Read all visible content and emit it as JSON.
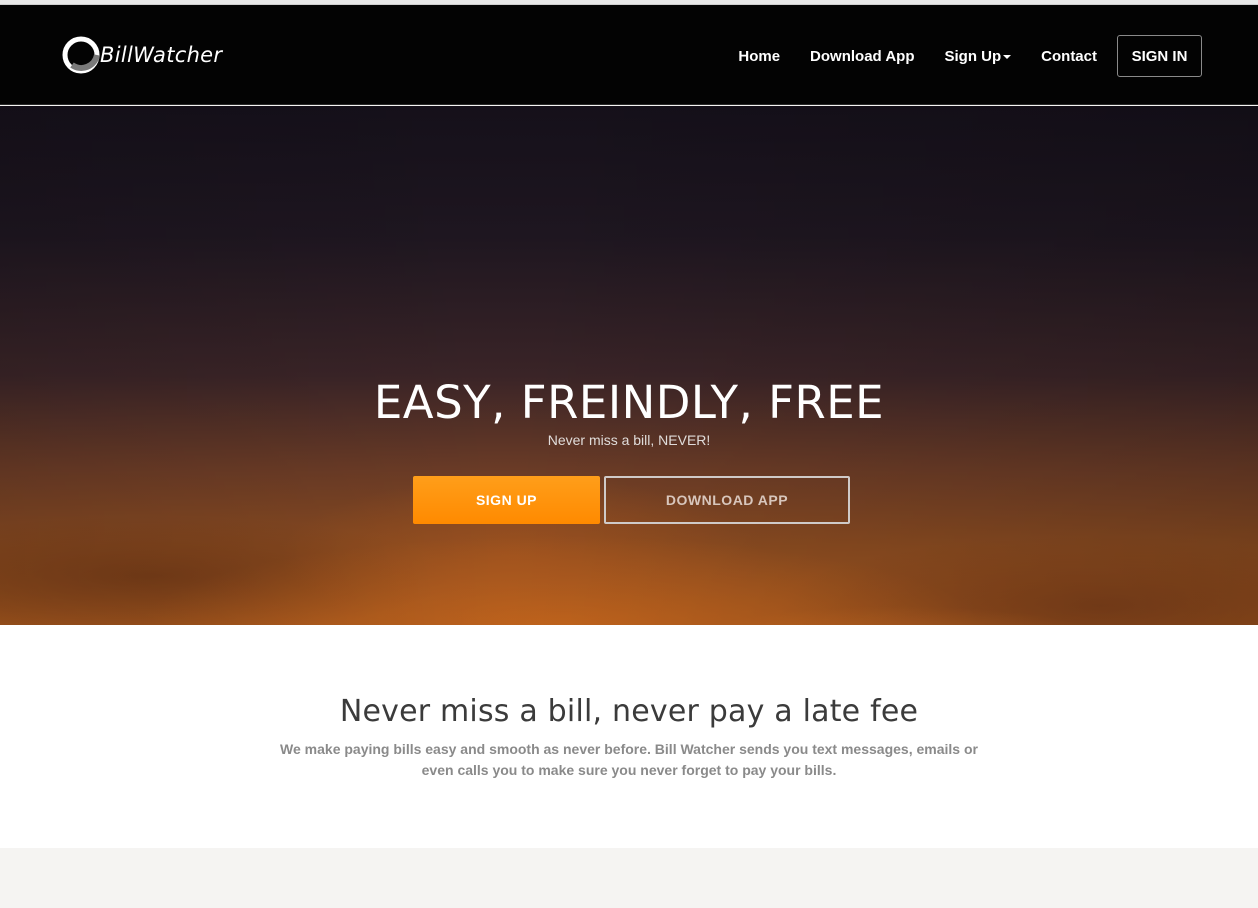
{
  "brand": {
    "name": "BillWatcher",
    "logo_icon": "circle-ring-icon",
    "colors": {
      "accent": "#ff8a00",
      "nav_bg": "#030303",
      "text_white": "#ffffff"
    }
  },
  "nav": {
    "items": [
      {
        "label": "Home"
      },
      {
        "label": "Download App"
      },
      {
        "label": "Sign Up",
        "has_dropdown": true
      },
      {
        "label": "Contact"
      }
    ],
    "signin_label": "SIGN IN"
  },
  "hero": {
    "title": "EASY, FREINDLY, FREE",
    "subtitle": "Never miss a bill, NEVER!",
    "primary_button": "SIGN UP",
    "secondary_button": "DOWNLOAD APP"
  },
  "feature": {
    "title": "Never miss a bill, never pay a late fee",
    "text": "We make paying bills easy and smooth as never before. Bill Watcher sends you text messages, emails or even calls you to make sure you never forget to pay your bills."
  }
}
